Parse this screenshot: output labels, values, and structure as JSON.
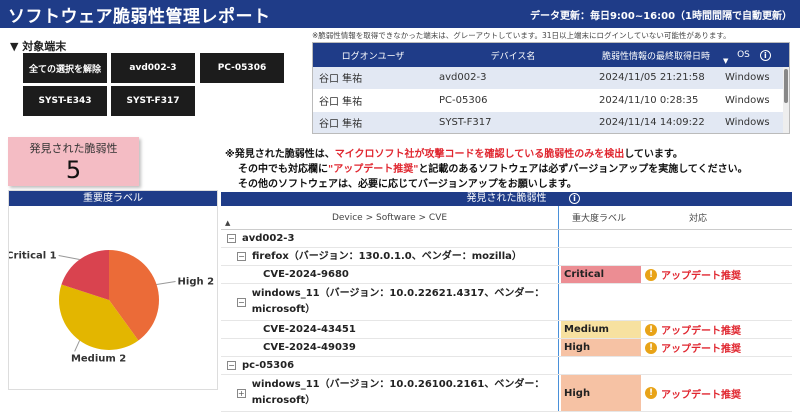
{
  "header": {
    "title": "ソフトウェア脆弱性管理レポート",
    "update": "データ更新：毎日9:00~16:00（1時間間隔で自動更新）"
  },
  "filter": {
    "title": "▼ 対象端末",
    "chips": [
      "全ての選択を解除",
      "avd002-3",
      "PC-05306",
      "SYST-E343",
      "SYST-F317"
    ]
  },
  "user_table": {
    "note": "※脆弱性情報を取得できなかった端末は、グレーアウトしています。31日以上端末にログインしていない可能性があります。",
    "headers": [
      "ログオンユーザ",
      "デバイス名",
      "脆弱性情報の最終取得日時",
      "OS"
    ],
    "rows": [
      {
        "user": "谷口 隼祐",
        "device": "avd002-3",
        "date": "2024/11/05 21:21:58",
        "os": "Windows"
      },
      {
        "user": "谷口 隼祐",
        "device": "PC-05306",
        "date": "2024/11/10 0:28:35",
        "os": "Windows"
      },
      {
        "user": "谷口 隼祐",
        "device": "SYST-F317",
        "date": "2024/11/14 14:09:22",
        "os": "Windows"
      }
    ]
  },
  "vuln_card": {
    "label": "発見された脆弱性",
    "count": "5"
  },
  "notice": {
    "line1_prefix": "※発見された脆弱性は、",
    "line1_red": "マイクロソフト社が攻撃コードを確認している脆弱性のみを検出",
    "line1_suffix": "しています。",
    "line2_prefix": "その中でも対応欄に",
    "line2_red": "\"アップデート推奨\"",
    "line2_suffix": "と記載のあるソフトウェアは必ずバージョンアップを実施してください。",
    "line3": "その他のソフトウェアは、必要に応じてバージョンアップをお願いします。"
  },
  "chart_panel": {
    "title": "重要度ラベル"
  },
  "chart_data": {
    "type": "pie",
    "categories": [
      "High",
      "Medium",
      "Critical"
    ],
    "values": [
      2,
      2,
      1
    ],
    "labels": [
      "High 2",
      "Medium 2",
      "Critical 1"
    ],
    "colors": [
      "#eb6b38",
      "#e3b600",
      "#d9434f"
    ]
  },
  "grid": {
    "title": "発見された脆弱性",
    "headers": [
      "Device > Software > CVE",
      "重大度ラベル",
      "対応"
    ],
    "rows": [
      {
        "level": 0,
        "expand": "⊟",
        "text": "avd002-3",
        "sev": "",
        "sevclass": "",
        "action": ""
      },
      {
        "level": 1,
        "expand": "⊟",
        "text": "firefox（バージョン：130.0.1.0、ベンダー：mozilla）",
        "sev": "",
        "sevclass": "",
        "action": ""
      },
      {
        "level": 2,
        "expand": "",
        "text": "CVE-2024-9680",
        "sev": "Critical",
        "sevclass": "sev-critical",
        "action": "アップデート推奨"
      },
      {
        "level": 1,
        "expand": "⊟",
        "text": "windows_11（バージョン：10.0.22621.4317、ベンダー：microsoft）",
        "sev": "",
        "sevclass": "",
        "action": "",
        "tall": true
      },
      {
        "level": 2,
        "expand": "",
        "text": "CVE-2024-43451",
        "sev": "Medium",
        "sevclass": "sev-medium",
        "action": "アップデート推奨"
      },
      {
        "level": 2,
        "expand": "",
        "text": "CVE-2024-49039",
        "sev": "High",
        "sevclass": "sev-high",
        "action": "アップデート推奨"
      },
      {
        "level": 0,
        "expand": "⊟",
        "text": "pc-05306",
        "sev": "",
        "sevclass": "",
        "action": ""
      },
      {
        "level": 1,
        "expand": "⊞",
        "text": "windows_11（バージョン：10.0.26100.2161、ベンダー：microsoft）",
        "sev": "High",
        "sevclass": "sev-high",
        "action": "アップデート推奨",
        "tall": true
      }
    ]
  }
}
